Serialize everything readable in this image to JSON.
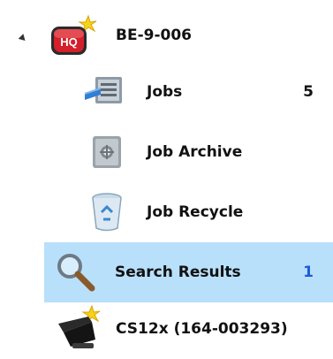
{
  "tree": {
    "root": {
      "label": "BE-9-006",
      "icon": "hq-server-icon",
      "badge_text": "HQ",
      "expanded": true
    },
    "children": [
      {
        "label": "Jobs",
        "count": "5",
        "icon": "jobs-icon"
      },
      {
        "label": "Job Archive",
        "count": "",
        "icon": "archive-vault-icon"
      },
      {
        "label": "Job Recycle",
        "count": "",
        "icon": "recycle-bin-icon"
      },
      {
        "label": "Search Results",
        "count": "1",
        "icon": "magnifier-icon",
        "selected": true
      }
    ],
    "sibling": {
      "label": "CS12x (164-003293)",
      "icon": "scanner-device-icon"
    }
  },
  "colors": {
    "selection_background": "#b8e0fb",
    "count_selected": "#1f5cd6",
    "hq_red": "#d4202a",
    "star_yellow": "#f7d21a"
  }
}
